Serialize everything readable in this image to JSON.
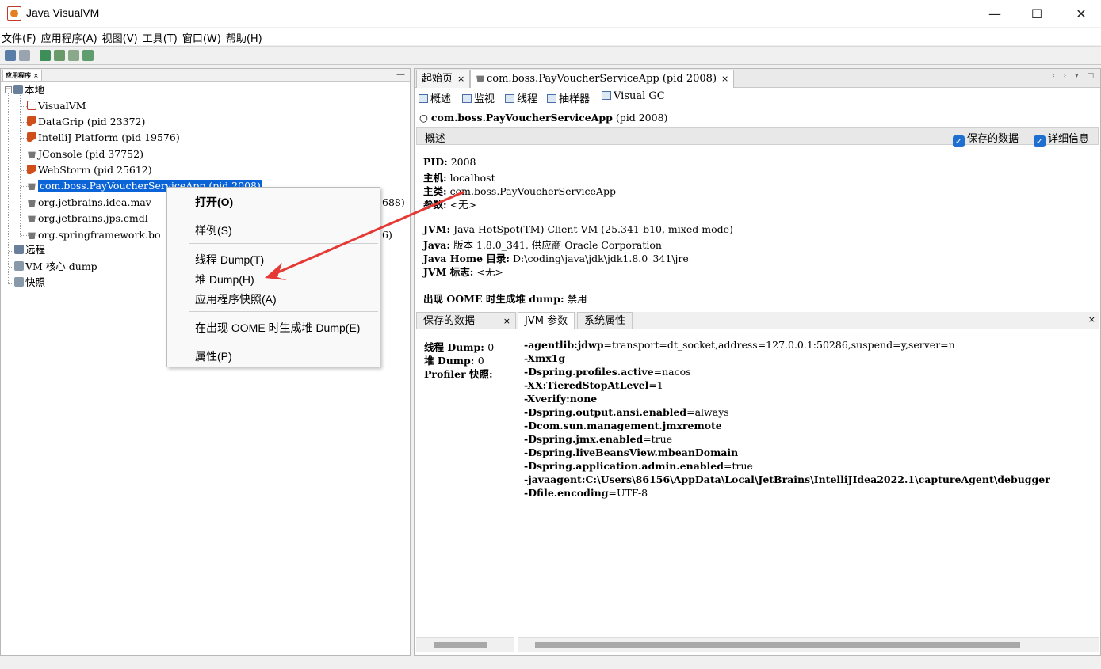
{
  "window": {
    "title": "Java VisualVM",
    "minimize_glyph": "—",
    "maximize_glyph": "☐",
    "close_glyph": "✕"
  },
  "menu": [
    "文件(F)",
    "应用程序(A)",
    "视图(V)",
    "工具(T)",
    "窗口(W)",
    "帮助(H)"
  ],
  "left_panel": {
    "tab_label": "应用程序",
    "tab_close": "×",
    "minimize": "—",
    "tree": {
      "local": "本地",
      "items": [
        {
          "icon": "visualvm-icon",
          "label": "VisualVM"
        },
        {
          "icon": "intellij-icon",
          "label": "DataGrip (pid 23372)"
        },
        {
          "icon": "intellij-icon",
          "label": "IntelliJ Platform (pid 19576)"
        },
        {
          "icon": "java-cup-icon",
          "label": "JConsole (pid 37752)"
        },
        {
          "icon": "intellij-icon",
          "label": "WebStorm (pid 25612)"
        },
        {
          "icon": "java-cup-icon",
          "label": "com.boss.PayVoucherServiceApp (pid 2008)"
        },
        {
          "icon": "java-cup-icon",
          "label": "org.jetbrains.idea.mav",
          "suffix": "688)"
        },
        {
          "icon": "java-cup-icon",
          "label": "org.jetbrains.jps.cmdl"
        },
        {
          "icon": "java-cup-icon",
          "label": "org.springframework.bo",
          "suffix": "6)"
        }
      ],
      "remote": "远程",
      "vm_core": "VM 核心 dump",
      "snapshots": "快照"
    }
  },
  "context_menu": {
    "open": "打开(O)",
    "sample": "样例(S)",
    "thread_dump": "线程 Dump(T)",
    "heap_dump": "堆 Dump(H)",
    "app_snapshot": "应用程序快照(A)",
    "oome_heap_dump": "在出现 OOME 时生成堆 Dump(E)",
    "properties": "属性(P)"
  },
  "right_panel": {
    "tabs": [
      {
        "label": "起始页",
        "close": "×"
      },
      {
        "label": "com.boss.PayVoucherServiceApp (pid 2008)",
        "close": "×"
      }
    ],
    "tab_nav": "‹ › ▾ □",
    "subtabs": [
      "概述",
      "监视",
      "线程",
      "抽样器",
      "Visual GC"
    ],
    "app_heading_name": "com.boss.PayVoucherServiceApp",
    "app_heading_pid": "(pid 2008)",
    "overview_label": "概述",
    "check_saved": "保存的数据",
    "check_details": "详细信息",
    "check_mark": "✓",
    "info": {
      "pid_label": "PID:",
      "pid_value": "2008",
      "host_label": "主机:",
      "host_value": "localhost",
      "main_label": "主类:",
      "main_value": "com.boss.PayVoucherServiceApp",
      "args_label": "参数:",
      "args_value": "<无>",
      "jvm_label": "JVM:",
      "jvm_value": "Java HotSpot(TM) Client VM (25.341-b10, mixed mode)",
      "java_label": "Java:",
      "java_value": "版本 1.8.0_341, 供应商 Oracle Corporation",
      "home_label": "Java Home 目录:",
      "home_value": "D:\\coding\\java\\jdk\\jdk1.8.0_341\\jre",
      "flags_label": "JVM 标志:",
      "flags_value": "<无>",
      "oome_label": "出现 OOME 时生成堆 dump:",
      "oome_value": "禁用"
    },
    "bottom_tabs": [
      {
        "label": "保存的数据",
        "close": "×"
      },
      {
        "label": "JVM 参数"
      },
      {
        "label": "系统属性"
      }
    ],
    "bottom_close": "×",
    "dump": {
      "thread_label": "线程 Dump:",
      "thread_value": "0",
      "heap_label": "堆 Dump:",
      "heap_value": "0",
      "profiler_label": "Profiler 快照:",
      "profiler_value": ""
    },
    "jvm_args": [
      {
        "key": "-agentlib:jdwp",
        "value": "=transport=dt_socket,address=127.0.0.1:50286,suspend=y,server=n"
      },
      {
        "key": "-Xmx1g",
        "value": ""
      },
      {
        "key": "-Dspring.profiles.active",
        "value": "=nacos"
      },
      {
        "key": "-XX:TieredStopAtLevel",
        "value": "=1"
      },
      {
        "key": "-Xverify:none",
        "value": ""
      },
      {
        "key": "-Dspring.output.ansi.enabled",
        "value": "=always"
      },
      {
        "key": "-Dcom.sun.management.jmxremote",
        "value": ""
      },
      {
        "key": "-Dspring.jmx.enabled",
        "value": "=true"
      },
      {
        "key": "-Dspring.liveBeansView.mbeanDomain",
        "value": ""
      },
      {
        "key": "-Dspring.application.admin.enabled",
        "value": "=true"
      },
      {
        "key": "-javaagent:C:\\Users\\86156\\AppData\\Local\\JetBrains\\IntelliJIdea2022.1\\captureAgent\\debugger",
        "value": ""
      },
      {
        "key": "-Dfile.encoding",
        "value": "=UTF-8"
      }
    ]
  },
  "colors": {
    "selection": "#0a64d8",
    "arrow": "#e53935",
    "checkbox": "#1f6fd0"
  }
}
